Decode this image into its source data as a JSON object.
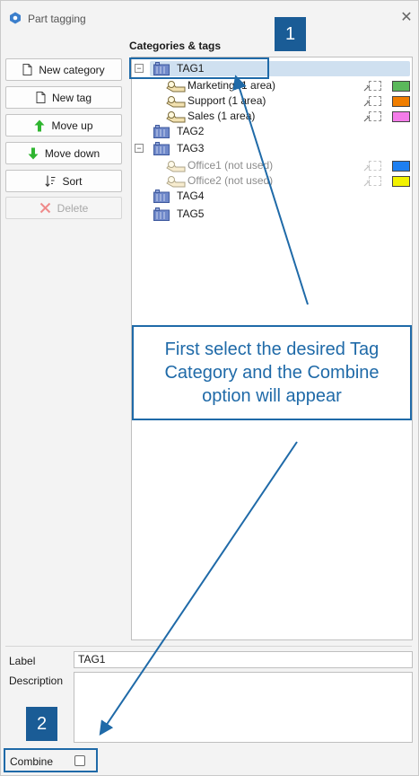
{
  "window": {
    "title": "Part tagging",
    "icon": "gear-hex-icon",
    "close_icon": "close-icon"
  },
  "panel": {
    "header": "Categories & tags"
  },
  "toolbar": {
    "new_category": "New category",
    "new_tag": "New tag",
    "move_up": "Move up",
    "move_down": "Move down",
    "sort": "Sort",
    "delete": "Delete"
  },
  "tree": {
    "tag1": {
      "label": "TAG1",
      "expanded": true,
      "selected": true
    },
    "tag1_children": [
      {
        "label": "Marketing (1 area)",
        "color": "#5bb85b"
      },
      {
        "label": "Support (1 area)",
        "color": "#f07e00"
      },
      {
        "label": "Sales (1 area)",
        "color": "#f47ce9"
      }
    ],
    "tag2": {
      "label": "TAG2"
    },
    "tag3": {
      "label": "TAG3",
      "expanded": true
    },
    "tag3_children": [
      {
        "label": "Office1 (not used)",
        "color": "#1e7ff0"
      },
      {
        "label": "Office2 (not used)",
        "color": "#f2f200"
      }
    ],
    "tag4": {
      "label": "TAG4"
    },
    "tag5": {
      "label": "TAG5"
    }
  },
  "form": {
    "label_caption": "Label",
    "label_value": "TAG1",
    "description_caption": "Description",
    "description_value": "",
    "combine_caption": "Combine",
    "combine_checked": false
  },
  "annotations": {
    "callout1": "1",
    "callout2": "2",
    "note": "First select the desired Tag Category and the Combine option will appear",
    "accent": "#1f6aa8",
    "badge_color": "#1a5c96"
  }
}
